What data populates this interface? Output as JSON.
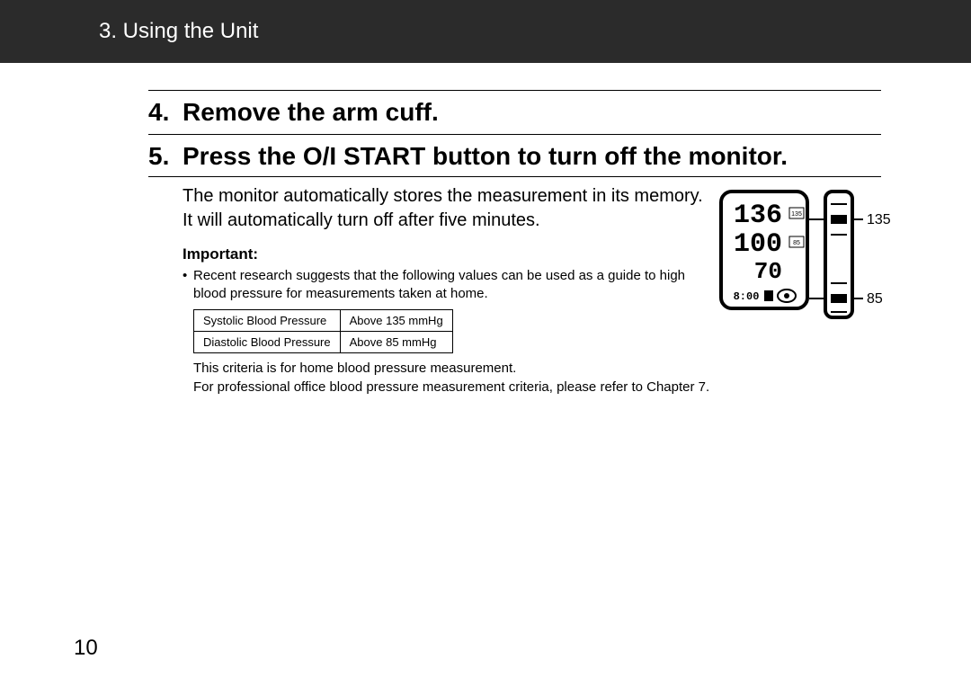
{
  "header": {
    "title": "3. Using the Unit"
  },
  "steps": [
    {
      "num": "4.",
      "text": "Remove the arm cuff."
    },
    {
      "num": "5.",
      "text": "Press the O/I START button to turn off the monitor."
    }
  ],
  "body": {
    "line1": "The monitor automatically stores the measurement in its memory.",
    "line2": "It will automatically turn off after five minutes."
  },
  "important": {
    "label": "Important:",
    "bullet": "Recent research suggests that the following values can be used as a guide to high blood pressure for measurements taken at home.",
    "table": {
      "r1c1": "Systolic Blood Pressure",
      "r1c2": "Above 135 mmHg",
      "r2c1": "Diastolic Blood Pressure",
      "r2c2": "Above 85 mmHg"
    },
    "post1": "This criteria is for home blood pressure measurement.",
    "post2": "For professional office blood pressure measurement criteria, please refer to Chapter 7."
  },
  "illustration": {
    "sys": "136",
    "dia": "100",
    "pulse": "70",
    "time": "8:00",
    "tag135": "135",
    "tag85": "85",
    "scale135": "135",
    "scale85": "85"
  },
  "pageNumber": "10"
}
